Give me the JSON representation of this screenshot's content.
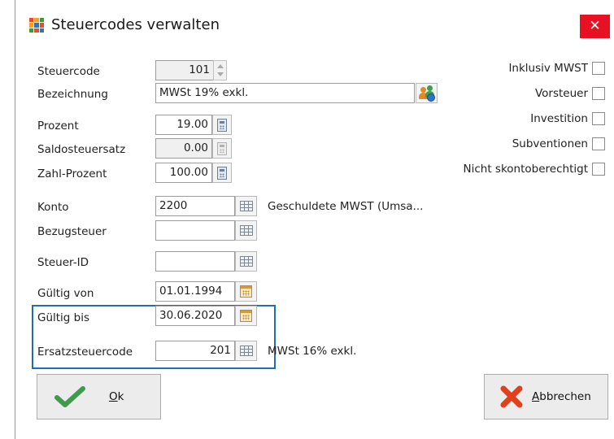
{
  "window": {
    "title": "Steuercodes verwalten",
    "close_glyph": "✕"
  },
  "fields": {
    "steuercode": {
      "label": "Steuercode",
      "value": "101"
    },
    "bezeichnung": {
      "label": "Bezeichnung",
      "value": "MWSt 19% exkl."
    },
    "prozent": {
      "label": "Prozent",
      "value": "19.00"
    },
    "saldosteuersatz": {
      "label": "Saldosteuersatz",
      "value": "0.00"
    },
    "zahl_prozent": {
      "label": "Zahl-Prozent",
      "value": "100.00"
    },
    "konto": {
      "label": "Konto",
      "value": "2200",
      "description": "Geschuldete MWST (Umsa..."
    },
    "bezugsteuer": {
      "label": "Bezugsteuer",
      "value": ""
    },
    "steuer_id": {
      "label": "Steuer-ID",
      "value": ""
    },
    "gueltig_von": {
      "label": "Gültig von",
      "value": "01.01.1994"
    },
    "gueltig_bis": {
      "label": "Gültig bis",
      "value": "30.06.2020"
    },
    "ersatzsteuercode": {
      "label": "Ersatzsteuercode",
      "value": "201",
      "description": "MWSt 16% exkl."
    }
  },
  "checkboxes": [
    {
      "label": "Inklusiv MWST",
      "checked": false
    },
    {
      "label": "Vorsteuer",
      "checked": false
    },
    {
      "label": "Investition",
      "checked": false
    },
    {
      "label": "Subventionen",
      "checked": false
    },
    {
      "label": "Nicht skontoberechtigt",
      "checked": false
    }
  ],
  "buttons": {
    "ok": {
      "mnemonic": "O",
      "rest": "k"
    },
    "cancel": {
      "mnemonic": "A",
      "rest": "bbrechen"
    }
  },
  "colors": {
    "close_bg": "#e81123",
    "highlight_border": "#1f6fb2",
    "ok_check": "#3f9a4c",
    "cancel_x": "#e0401c"
  },
  "icons": {
    "app": "app-grid-icon",
    "spinner": "spinner-icon",
    "calculator": "calculator-icon",
    "lookup": "table-lookup-icon",
    "calendar": "calendar-icon",
    "users": "users-globe-icon",
    "ok": "checkmark-icon",
    "cancel": "cross-icon"
  }
}
